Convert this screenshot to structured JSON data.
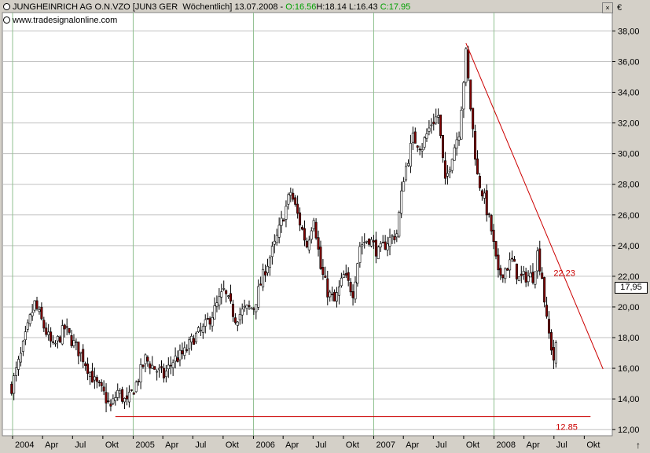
{
  "header": {
    "title_prefix": "JUNGHEINRICH AG O.N.VZO [JUN3 GER  Wöchentlich] 13.07.2008 - ",
    "open": "O:16.56",
    "high": "H:18.14",
    "low": "L:16.43",
    "close": "C:17.95",
    "source": "www.tradesignalonline.com",
    "currency": "€",
    "close_button": "×",
    "scroll_arrow": "↑"
  },
  "colors": {
    "background": "#ffffff",
    "frame": "#d4d0c8",
    "grid_horizontal": "#c0c0c0",
    "grid_vertical": "#90c090",
    "up_candle": "#ffffff",
    "down_candle": "#800000",
    "wick": "#000000",
    "trendline": "#cc0000",
    "close_text": "#00a000"
  },
  "chart_data": {
    "type": "candlestick",
    "ylim": [
      11.6,
      39.2
    ],
    "y_ticks": [
      "12,00",
      "14,00",
      "16,00",
      "18,00",
      "20,00",
      "22,00",
      "24,00",
      "26,00",
      "28,00",
      "30,00",
      "32,00",
      "34,00",
      "36,00",
      "38,00"
    ],
    "x_ticks": [
      "2004",
      "Apr",
      "Jul",
      "Okt",
      "2005",
      "Apr",
      "Jul",
      "Okt",
      "2006",
      "Apr",
      "Jul",
      "Okt",
      "2007",
      "Apr",
      "Jul",
      "Okt",
      "2008",
      "Apr",
      "Jul",
      "Okt"
    ],
    "year_ticks": [
      "2004",
      "2005",
      "2006",
      "2007",
      "2008"
    ],
    "last_price_label": "17,95",
    "close_series": [
      {
        "d": "2003-12-29",
        "c": 14.8
      },
      {
        "d": "2004-01-26",
        "c": 16.8
      },
      {
        "d": "2004-02-23",
        "c": 19.2
      },
      {
        "d": "2004-03-08",
        "c": 20.2
      },
      {
        "d": "2004-04-05",
        "c": 18.7
      },
      {
        "d": "2004-05-03",
        "c": 17.3
      },
      {
        "d": "2004-06-07",
        "c": 18.6
      },
      {
        "d": "2004-07-05",
        "c": 17.6
      },
      {
        "d": "2004-08-02",
        "c": 16.7
      },
      {
        "d": "2004-09-06",
        "c": 15.1
      },
      {
        "d": "2004-10-04",
        "c": 14.3
      },
      {
        "d": "2004-10-25",
        "c": 13.4
      },
      {
        "d": "2004-11-15",
        "c": 14.5
      },
      {
        "d": "2004-12-13",
        "c": 13.7
      },
      {
        "d": "2005-01-10",
        "c": 15.0
      },
      {
        "d": "2005-02-07",
        "c": 16.6
      },
      {
        "d": "2005-03-07",
        "c": 16.0
      },
      {
        "d": "2005-04-04",
        "c": 15.5
      },
      {
        "d": "2005-05-02",
        "c": 16.5
      },
      {
        "d": "2005-06-06",
        "c": 17.0
      },
      {
        "d": "2005-07-04",
        "c": 18.0
      },
      {
        "d": "2005-08-01",
        "c": 18.5
      },
      {
        "d": "2005-09-05",
        "c": 19.8
      },
      {
        "d": "2005-10-03",
        "c": 21.0
      },
      {
        "d": "2005-11-07",
        "c": 19.3
      },
      {
        "d": "2005-12-05",
        "c": 19.8
      },
      {
        "d": "2006-01-02",
        "c": 20.0
      },
      {
        "d": "2006-02-06",
        "c": 22.5
      },
      {
        "d": "2006-03-06",
        "c": 24.0
      },
      {
        "d": "2006-04-03",
        "c": 26.0
      },
      {
        "d": "2006-04-24",
        "c": 27.5
      },
      {
        "d": "2006-05-15",
        "c": 26.0
      },
      {
        "d": "2006-06-12",
        "c": 24.0
      },
      {
        "d": "2006-07-03",
        "c": 26.0
      },
      {
        "d": "2006-07-24",
        "c": 22.5
      },
      {
        "d": "2006-08-14",
        "c": 21.0
      },
      {
        "d": "2006-09-04",
        "c": 20.3
      },
      {
        "d": "2006-10-02",
        "c": 22.0
      },
      {
        "d": "2006-10-30",
        "c": 21.0
      },
      {
        "d": "2006-11-20",
        "c": 24.0
      },
      {
        "d": "2006-12-18",
        "c": 24.5
      },
      {
        "d": "2007-01-15",
        "c": 23.5
      },
      {
        "d": "2007-02-12",
        "c": 24.3
      },
      {
        "d": "2007-03-12",
        "c": 24.8
      },
      {
        "d": "2007-04-02",
        "c": 28.5
      },
      {
        "d": "2007-04-30",
        "c": 31.0
      },
      {
        "d": "2007-05-28",
        "c": 30.5
      },
      {
        "d": "2007-06-25",
        "c": 32.0
      },
      {
        "d": "2007-07-16",
        "c": 32.5
      },
      {
        "d": "2007-08-06",
        "c": 28.0
      },
      {
        "d": "2007-08-27",
        "c": 30.0
      },
      {
        "d": "2007-09-17",
        "c": 31.5
      },
      {
        "d": "2007-10-08",
        "c": 36.5
      },
      {
        "d": "2007-10-22",
        "c": 33.0
      },
      {
        "d": "2007-11-12",
        "c": 28.5
      },
      {
        "d": "2007-12-03",
        "c": 27.0
      },
      {
        "d": "2007-12-24",
        "c": 25.0
      },
      {
        "d": "2008-01-14",
        "c": 22.0
      },
      {
        "d": "2008-02-04",
        "c": 22.5
      },
      {
        "d": "2008-02-25",
        "c": 23.0
      },
      {
        "d": "2008-03-17",
        "c": 21.8
      },
      {
        "d": "2008-04-07",
        "c": 22.0
      },
      {
        "d": "2008-04-28",
        "c": 22.0
      },
      {
        "d": "2008-05-12",
        "c": 23.5
      },
      {
        "d": "2008-05-26",
        "c": 22.0
      },
      {
        "d": "2008-06-09",
        "c": 19.0
      },
      {
        "d": "2008-06-30",
        "c": 16.6
      },
      {
        "d": "2008-07-13",
        "c": 17.95
      }
    ],
    "trendlines": [
      {
        "x0": "2007-10-08",
        "y0": 37.2,
        "x1": "2008-11-27",
        "y1": 15.95,
        "label": "22.23",
        "label_x": "2008-06-30",
        "label_y": 22.23
      },
      {
        "x0": "2004-11-08",
        "y0": 12.85,
        "x1": "2008-10-20",
        "y1": 12.85,
        "label": "12.85",
        "label_x": "2008-07-07",
        "label_y": 12.2
      }
    ]
  }
}
